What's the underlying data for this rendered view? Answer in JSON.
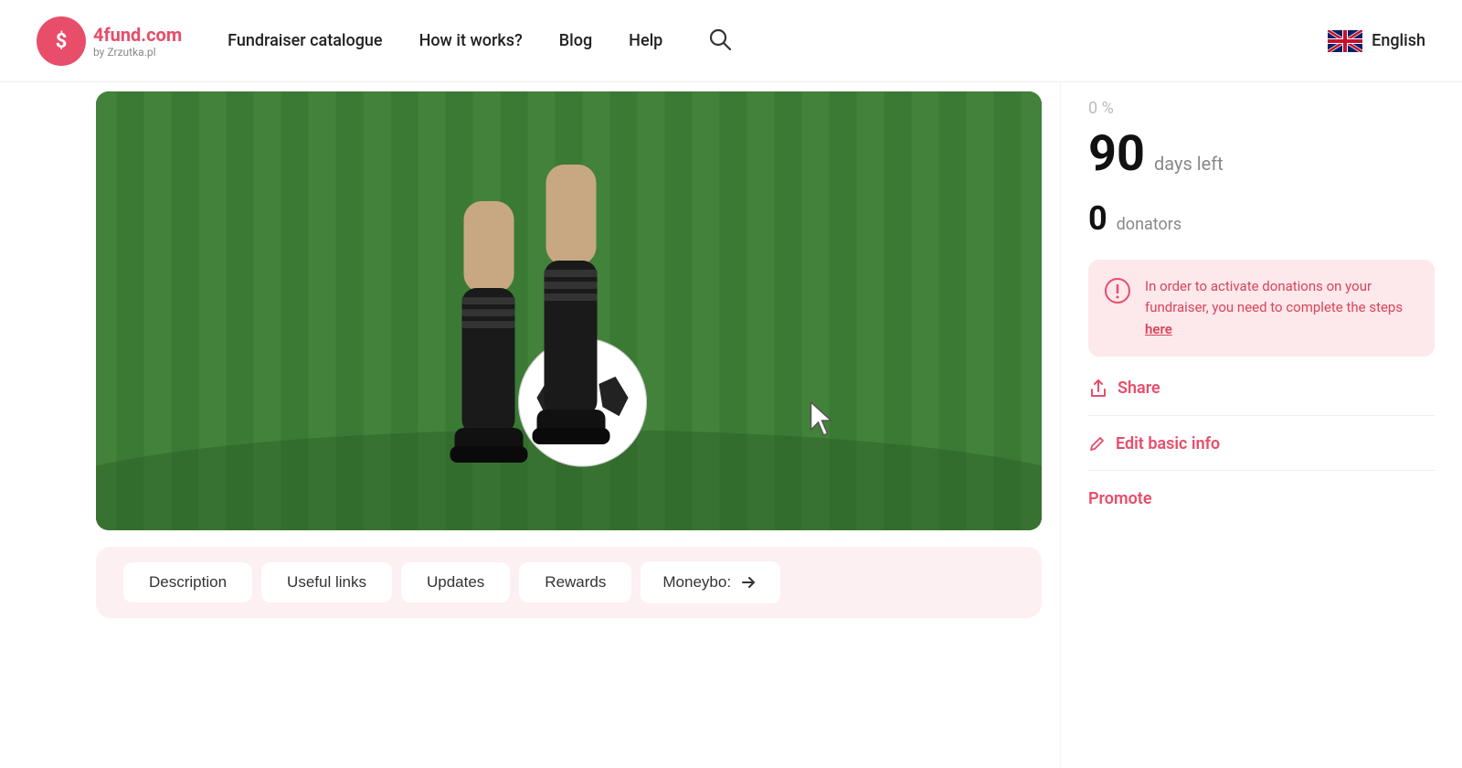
{
  "header": {
    "logo_text": "4fund.com",
    "logo_sub": "by Zrzutka.pl",
    "nav": [
      {
        "label": "Fundraiser catalogue",
        "id": "fundraiser-catalogue"
      },
      {
        "label": "How it works?",
        "id": "how-it-works"
      },
      {
        "label": "Blog",
        "id": "blog"
      },
      {
        "label": "Help",
        "id": "help"
      }
    ],
    "language": "English"
  },
  "stats": {
    "percent": "0 %",
    "days_number": "90",
    "days_label": "days left",
    "donators_number": "0",
    "donators_label": "donators"
  },
  "warning": {
    "text": "In order to activate donations on your fundraiser, you need to complete the steps",
    "link_text": "here"
  },
  "actions": {
    "share_label": "Share",
    "edit_label": "Edit basic info",
    "promote_label": "Promote"
  },
  "tabs": [
    {
      "label": "Description"
    },
    {
      "label": "Useful links"
    },
    {
      "label": "Updates"
    },
    {
      "label": "Rewards"
    },
    {
      "label": "Moneybo:"
    }
  ]
}
